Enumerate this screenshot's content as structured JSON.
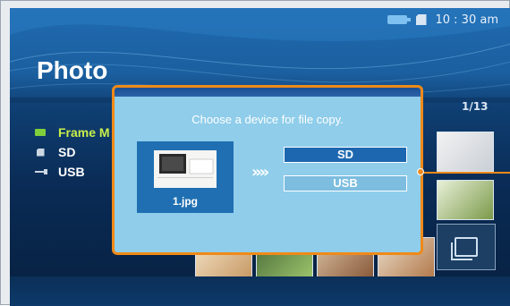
{
  "status_bar": {
    "usb_icon": "usb-connected-icon",
    "card_icon": "memory-card-icon",
    "time": "10 : 30 am"
  },
  "page_title": "Photo",
  "sidebar": {
    "items": [
      {
        "label": "Frame M",
        "icon": "frame-memory-icon",
        "active": true
      },
      {
        "label": "SD",
        "icon": "sd-card-icon",
        "active": false
      },
      {
        "label": "USB",
        "icon": "usb-icon",
        "active": false
      }
    ]
  },
  "pager": "1/13",
  "dialog": {
    "message": "Choose a device for file copy.",
    "file_name": "1.jpg",
    "arrow_glyph": "»»",
    "options": [
      "SD",
      "USB"
    ],
    "selected": "SD"
  },
  "colors": {
    "accent_orange": "#ef8a18",
    "dialog_bg": "#8fcdea",
    "selected_option": "#1d67b0",
    "active_sidebar": "#c8ef4a"
  }
}
